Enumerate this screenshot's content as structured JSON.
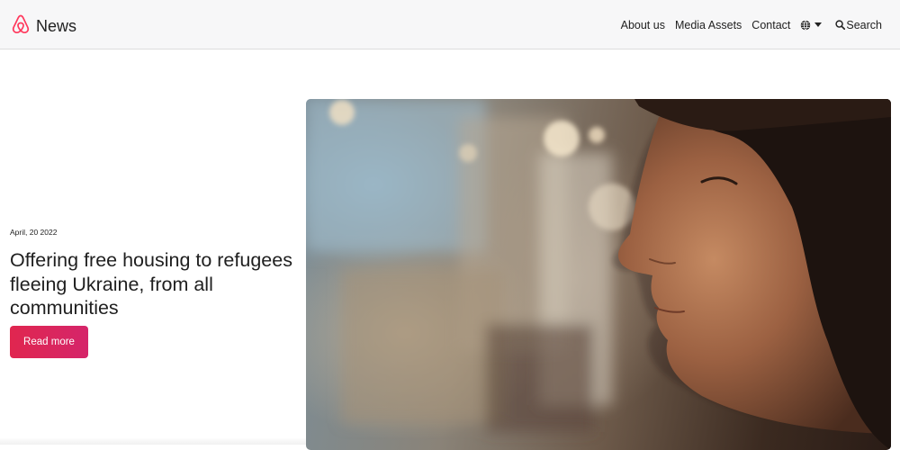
{
  "header": {
    "brand": "News",
    "nav": {
      "about": "About us",
      "media": "Media Assets",
      "contact": "Contact",
      "search": "Search"
    }
  },
  "hero": {
    "date": "April, 20 2022",
    "title": "Offering free housing to refugees fleeing Ukraine, from all communities",
    "cta": "Read more"
  },
  "colors": {
    "brand": "#ff385c",
    "cta": "#e0264f",
    "header_bg": "#f7f7f8"
  },
  "icons": [
    "airbnb-logo-icon",
    "globe-icon",
    "caret-down-icon",
    "search-icon"
  ]
}
